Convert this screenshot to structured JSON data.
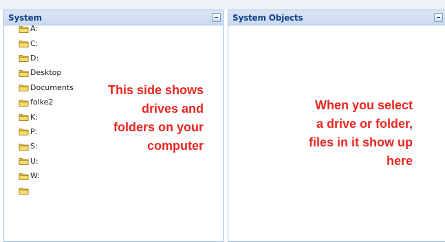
{
  "left_panel": {
    "title": "System",
    "items": [
      {
        "label": "A:"
      },
      {
        "label": "C:"
      },
      {
        "label": "D:"
      },
      {
        "label": "Desktop"
      },
      {
        "label": "Documents"
      },
      {
        "label": "folke2"
      },
      {
        "label": "K:"
      },
      {
        "label": "P:"
      },
      {
        "label": "S:"
      },
      {
        "label": "U:"
      },
      {
        "label": "W:"
      }
    ],
    "annotation": [
      "This side shows",
      "drives and",
      "folders on your",
      "computer"
    ]
  },
  "right_panel": {
    "title": "System Objects",
    "annotation": [
      "When you select",
      "a drive or folder,",
      "files in it show up",
      "here"
    ]
  },
  "colors": {
    "annotation": "#e8261f",
    "header_text": "#15428b",
    "panel_border": "#99bbe8"
  },
  "icons": {
    "tree_item": "folder-icon",
    "panel_tool": "collapse-icon"
  }
}
